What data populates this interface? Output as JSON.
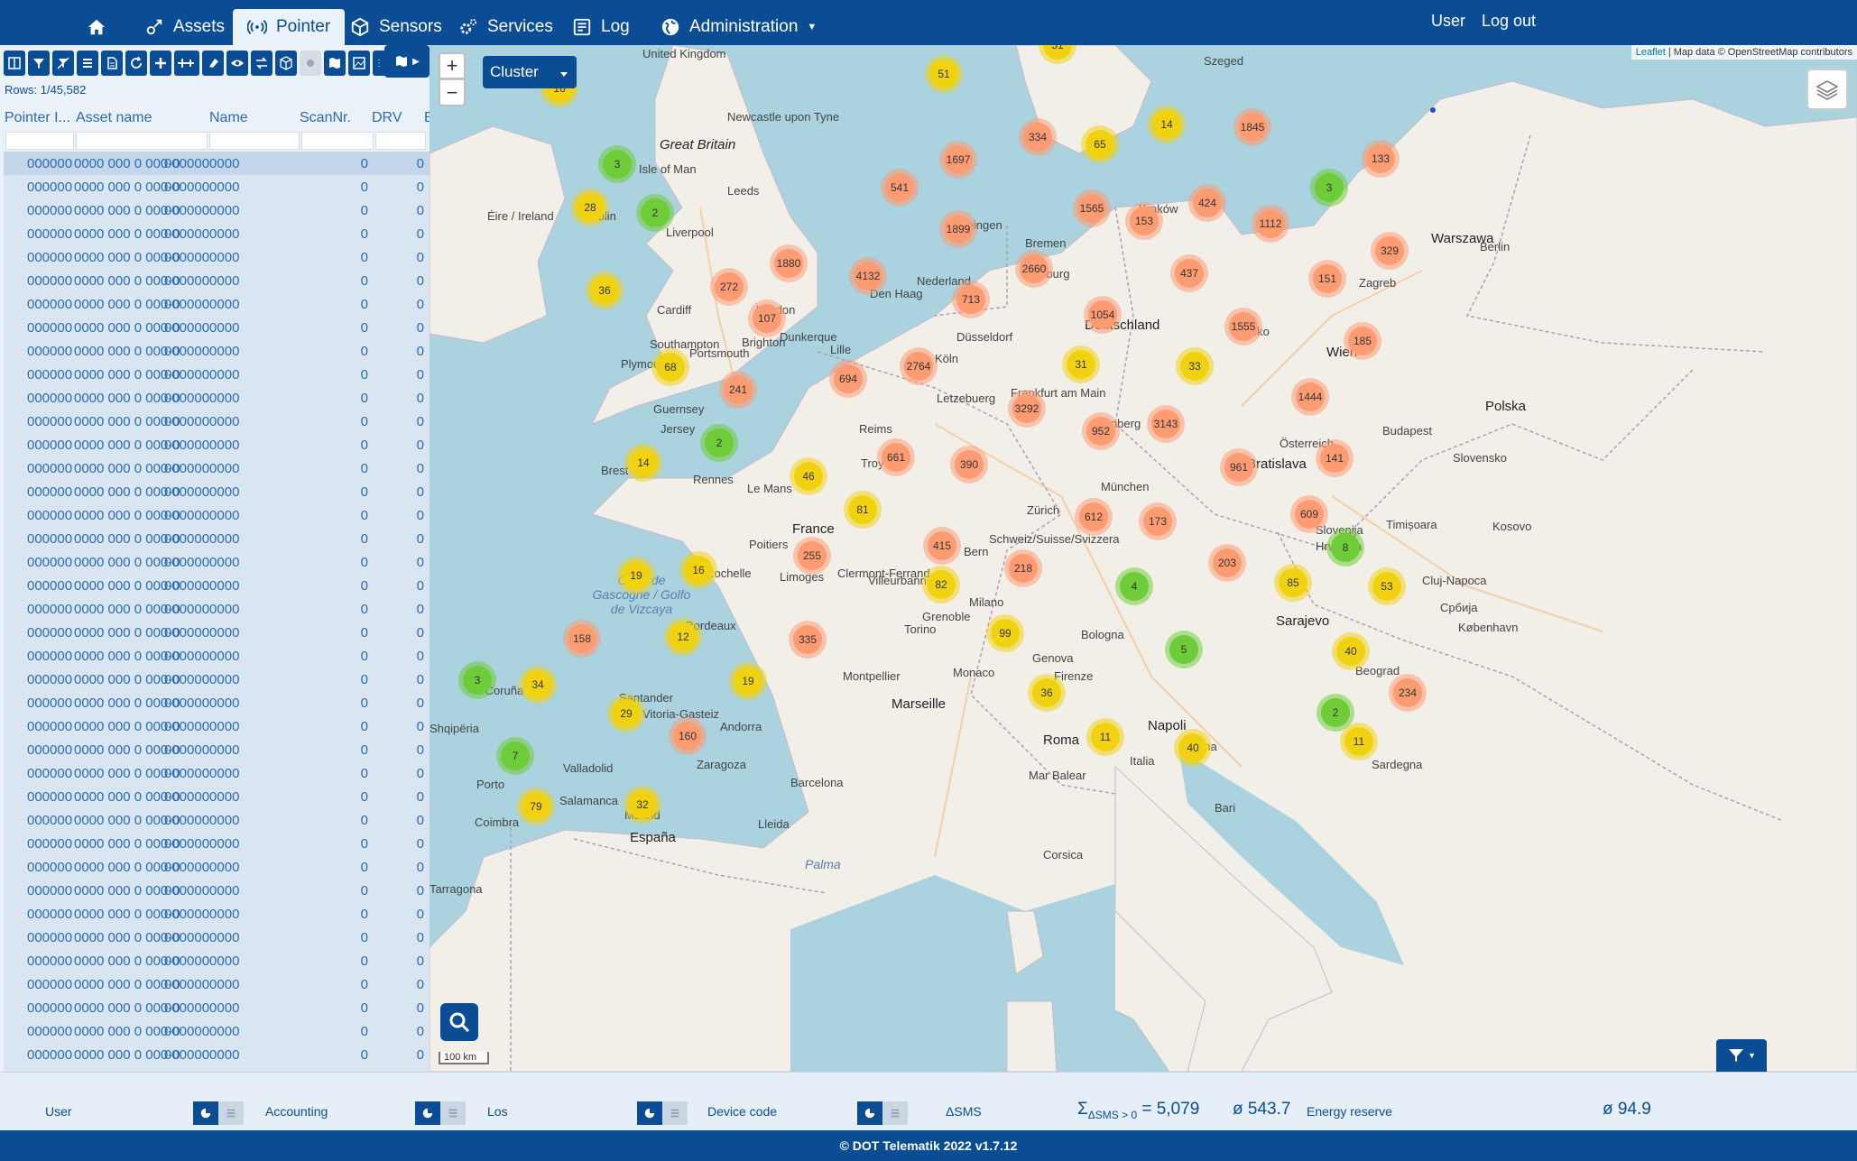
{
  "nav": {
    "items": [
      {
        "label": ""
      },
      {
        "label": "Assets"
      },
      {
        "label": "Pointer"
      },
      {
        "label": "Sensors"
      },
      {
        "label": "Services"
      },
      {
        "label": "Log"
      },
      {
        "label": "Administration"
      }
    ],
    "user_label": "User",
    "logout_label": "Log out",
    "active": "Pointer"
  },
  "table": {
    "rows_count": "Rows: 1/45,582",
    "columns": [
      "Pointer I...",
      "Asset name",
      "Name",
      "ScanNr.",
      "DRV",
      "E"
    ],
    "row_template": [
      "000000",
      "0000 000 0 000-0",
      "0000000000",
      "0",
      "0"
    ],
    "row_count_visible": 39
  },
  "map": {
    "cluster_label": "Cluster",
    "zoom_in": "+",
    "zoom_out": "−",
    "attribution_leaflet": "Leaflet",
    "attribution_text": "| Map data © OpenStreetMap contributors",
    "scale": "100 km",
    "labels": [
      "United Kingdom",
      "Great Britain",
      "Isle of Man",
      "Éire / Ireland",
      "Dublin",
      "Newcastle upon Tyne",
      "Leeds",
      "Liverpool",
      "Cardiff",
      "London",
      "Plymouth",
      "Southampton",
      "Portsmouth",
      "Brighton",
      "Guernsey",
      "Jersey",
      "Brest",
      "Rennes",
      "Le Mans",
      "Poitiers",
      "La Rochelle",
      "Limoges",
      "Bordeaux",
      "France",
      "Reims",
      "Troyes",
      "Lille",
      "Dunkerque",
      "Clermont-Ferrand",
      "Villeurbanne",
      "Grenoble",
      "Marseille",
      "Montpellier",
      "Monaco",
      "Genova",
      "Andorra",
      "Barcelona",
      "Zaragoza",
      "Madrid",
      "España",
      "Valladolid",
      "Salamanca",
      "Porto",
      "Coimbra",
      "Santander",
      "Vitoria-Gasteiz",
      "A Coruña",
      "Golfe de Gascogne / Golfo de Vizcaya",
      "Den Haag",
      "Nederland",
      "Groningen",
      "Bremen",
      "Hamburg",
      "Deutschland",
      "Frankfurt am Main",
      "Nürnberg",
      "München",
      "Düsseldorf",
      "Köln",
      "Letzebuerg",
      "Schweiz/Suisse/Svizzera",
      "Zürich",
      "Bern",
      "Milano",
      "Torino",
      "Bologna",
      "Firenze",
      "Roma",
      "Italia",
      "Napoli",
      "Bari",
      "Praha",
      "Česko",
      "Wien",
      "Österreich",
      "Bratislava",
      "Budapest",
      "Slovensko",
      "Polska",
      "Warszawa",
      "Berlin",
      "Kraków",
      "Zagreb",
      "Slovenija",
      "Hrvatska",
      "Sarajevo",
      "Beograd",
      "Србија",
      "København",
      "Szeged",
      "Timișoara",
      "Cluj-Napoca",
      "Kosovo",
      "Shqipëria",
      "Sardegna",
      "Corsica",
      "Mar Balear",
      "Palma",
      "Tarragona",
      "Lleida"
    ],
    "clusters": [
      {
        "v": "51",
        "c": "#f1d211"
      },
      {
        "v": "16",
        "c": "#f1d211"
      },
      {
        "v": "51",
        "c": "#f1d211"
      },
      {
        "v": "3",
        "c": "#6ecc39"
      },
      {
        "v": "28",
        "c": "#f1d211"
      },
      {
        "v": "2",
        "c": "#6ecc39"
      },
      {
        "v": "36",
        "c": "#f1d211"
      },
      {
        "v": "1697",
        "c": "#fd9c73"
      },
      {
        "v": "334",
        "c": "#fd9c73"
      },
      {
        "v": "65",
        "c": "#f1d211"
      },
      {
        "v": "14",
        "c": "#f1d211"
      },
      {
        "v": "1845",
        "c": "#fd9c73"
      },
      {
        "v": "133",
        "c": "#fd9c73"
      },
      {
        "v": "541",
        "c": "#fd9c73"
      },
      {
        "v": "1565",
        "c": "#fd9c73"
      },
      {
        "v": "424",
        "c": "#fd9c73"
      },
      {
        "v": "3",
        "c": "#6ecc39"
      },
      {
        "v": "1899",
        "c": "#fd9c73"
      },
      {
        "v": "153",
        "c": "#fd9c73"
      },
      {
        "v": "1112",
        "c": "#fd9c73"
      },
      {
        "v": "329",
        "c": "#fd9c73"
      },
      {
        "v": "1880",
        "c": "#fd9c73"
      },
      {
        "v": "4132",
        "c": "#fd9c73"
      },
      {
        "v": "2660",
        "c": "#fd9c73"
      },
      {
        "v": "437",
        "c": "#fd9c73"
      },
      {
        "v": "151",
        "c": "#fd9c73"
      },
      {
        "v": "272",
        "c": "#fd9c73"
      },
      {
        "v": "713",
        "c": "#fd9c73"
      },
      {
        "v": "107",
        "c": "#fd9c73"
      },
      {
        "v": "1054",
        "c": "#fd9c73"
      },
      {
        "v": "1555",
        "c": "#fd9c73"
      },
      {
        "v": "185",
        "c": "#fd9c73"
      },
      {
        "v": "68",
        "c": "#f1d211"
      },
      {
        "v": "2764",
        "c": "#fd9c73"
      },
      {
        "v": "31",
        "c": "#f1d211"
      },
      {
        "v": "33",
        "c": "#f1d211"
      },
      {
        "v": "241",
        "c": "#fd9c73"
      },
      {
        "v": "694",
        "c": "#fd9c73"
      },
      {
        "v": "1444",
        "c": "#fd9c73"
      },
      {
        "v": "3292",
        "c": "#fd9c73"
      },
      {
        "v": "3143",
        "c": "#fd9c73"
      },
      {
        "v": "952",
        "c": "#fd9c73"
      },
      {
        "v": "2",
        "c": "#6ecc39"
      },
      {
        "v": "661",
        "c": "#fd9c73"
      },
      {
        "v": "390",
        "c": "#fd9c73"
      },
      {
        "v": "141",
        "c": "#fd9c73"
      },
      {
        "v": "14",
        "c": "#f1d211"
      },
      {
        "v": "961",
        "c": "#fd9c73"
      },
      {
        "v": "46",
        "c": "#f1d211"
      },
      {
        "v": "81",
        "c": "#f1d211"
      },
      {
        "v": "612",
        "c": "#fd9c73"
      },
      {
        "v": "173",
        "c": "#fd9c73"
      },
      {
        "v": "609",
        "c": "#fd9c73"
      },
      {
        "v": "415",
        "c": "#fd9c73"
      },
      {
        "v": "8",
        "c": "#6ecc39"
      },
      {
        "v": "255",
        "c": "#fd9c73"
      },
      {
        "v": "218",
        "c": "#fd9c73"
      },
      {
        "v": "203",
        "c": "#fd9c73"
      },
      {
        "v": "19",
        "c": "#f1d211"
      },
      {
        "v": "16",
        "c": "#f1d211"
      },
      {
        "v": "82",
        "c": "#f1d211"
      },
      {
        "v": "4",
        "c": "#6ecc39"
      },
      {
        "v": "85",
        "c": "#f1d211"
      },
      {
        "v": "53",
        "c": "#f1d211"
      },
      {
        "v": "158",
        "c": "#fd9c73"
      },
      {
        "v": "12",
        "c": "#f1d211"
      },
      {
        "v": "335",
        "c": "#fd9c73"
      },
      {
        "v": "99",
        "c": "#f1d211"
      },
      {
        "v": "5",
        "c": "#6ecc39"
      },
      {
        "v": "40",
        "c": "#f1d211"
      },
      {
        "v": "3",
        "c": "#6ecc39"
      },
      {
        "v": "34",
        "c": "#f1d211"
      },
      {
        "v": "4",
        "c": "#6ecc39"
      },
      {
        "v": "19",
        "c": "#f1d211"
      },
      {
        "v": "36",
        "c": "#f1d211"
      },
      {
        "v": "234",
        "c": "#fd9c73"
      },
      {
        "v": "29",
        "c": "#f1d211"
      },
      {
        "v": "2",
        "c": "#6ecc39"
      },
      {
        "v": "17",
        "c": "#f1d211"
      },
      {
        "v": "160",
        "c": "#fd9c73"
      },
      {
        "v": "11",
        "c": "#f1d211"
      },
      {
        "v": "40",
        "c": "#f1d211"
      },
      {
        "v": "11",
        "c": "#f1d211"
      },
      {
        "v": "7",
        "c": "#6ecc39"
      },
      {
        "v": "79",
        "c": "#f1d211"
      },
      {
        "v": "32",
        "c": "#f1d211"
      }
    ]
  },
  "bottom": {
    "groups": [
      {
        "label": "User"
      },
      {
        "label": "Accounting"
      },
      {
        "label": "Los"
      },
      {
        "label": "Device code"
      }
    ],
    "dsms_label": "ΔSMS",
    "sum_label": "Σ",
    "sum_sub": "ΔSMS > 0",
    "sum_value": "= 5,079",
    "avg_dsms": "ø 543.7",
    "energy_label": "Energy reserve",
    "avg_energy": "ø 94.9"
  },
  "footer": {
    "text": "© DOT Telematik 2022 v1.7.12"
  },
  "colors": {
    "brand": "#0a4d94",
    "cluster_small": "#6ecc39",
    "cluster_medium": "#f1d211",
    "cluster_large": "#fd9c73"
  }
}
